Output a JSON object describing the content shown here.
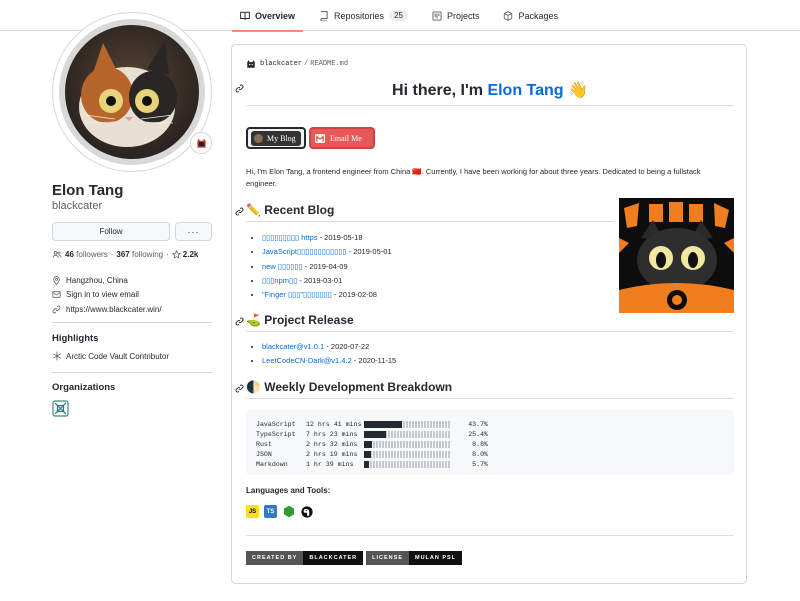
{
  "tabs": [
    {
      "label": "Overview",
      "active": true,
      "icon": "book-icon"
    },
    {
      "label": "Repositories",
      "count": "25",
      "icon": "repo-icon"
    },
    {
      "label": "Projects",
      "icon": "project-icon"
    },
    {
      "label": "Packages",
      "icon": "package-icon"
    }
  ],
  "profile": {
    "name": "Elon Tang",
    "login": "blackcater",
    "follow_label": "Follow",
    "more_label": "···",
    "followers_count": "46",
    "followers_label": "followers",
    "following_count": "367",
    "following_label": "following",
    "stars": "2.2k",
    "location": "Hangzhou, China",
    "email": "Sign in to view email",
    "website": "https://www.blackcater.win/"
  },
  "sidebar": {
    "highlights_title": "Highlights",
    "highlight_item": "Arctic Code Vault Contributor",
    "organizations_title": "Organizations"
  },
  "readme": {
    "path_user": "blackcater",
    "path_sep": "/",
    "path_file": "README.md",
    "greeting": "Hi there, I'm ",
    "greeting_name": "Elon Tang",
    "greeting_emoji": "👋",
    "badge_blog": "My Blog",
    "badge_email": "Email Me",
    "intro": "Hi, I'm Elon Tang, a frontend engineer from China 🇨🇳. Currently, I have been working for about three years. Dedicated to being a fullstack engineer.",
    "recent_blog_title": "✏️ Recent Blog",
    "blog_posts": [
      {
        "title": "▯▯▯▯▯▯▯▯▯ https",
        "date": " - 2019-05-18"
      },
      {
        "title": "JavaScript▯▯▯▯▯▯▯▯▯▯▯▯",
        "date": " - 2019-05-01"
      },
      {
        "title": "new ▯▯▯▯▯▯",
        "date": " - 2019-04-09"
      },
      {
        "title": "▯▯▯npm▯▯",
        "date": " - 2019-03-01"
      },
      {
        "title": "\"Finger ▯▯▯\"▯▯▯▯▯▯▯",
        "date": " - 2019-02-08"
      }
    ],
    "project_release_title": "⛳ Project Release",
    "releases": [
      {
        "title": "blackcater@v1.0.1",
        "date": " - 2020-07-22"
      },
      {
        "title": "LeetCodeCN-Dark@v1.4.2",
        "date": " - 2020-11-15"
      }
    ],
    "weekly_title": "🌓 Weekly Development Breakdown",
    "weekly": [
      {
        "lang": "JavaScript",
        "time": "12 hrs 41 mins",
        "percent": 43.7,
        "percent_label": "43.7%"
      },
      {
        "lang": "TypeScript",
        "time": "7 hrs 23 mins",
        "percent": 25.4,
        "percent_label": "25.4%"
      },
      {
        "lang": "Rust",
        "time": "2 hrs 32 mins",
        "percent": 8.8,
        "percent_label": "8.8%"
      },
      {
        "lang": "JSON",
        "time": "2 hrs 19 mins",
        "percent": 8.0,
        "percent_label": "8.0%"
      },
      {
        "lang": "Markdown",
        "time": "1 hr 39 mins",
        "percent": 5.7,
        "percent_label": "5.7%"
      }
    ],
    "tools_title": "Languages and Tools:",
    "tools": [
      {
        "icon": "javascript-icon",
        "text": "JS",
        "bg": "#f7df1e",
        "fg": "#000000"
      },
      {
        "icon": "typescript-icon",
        "text": "TS",
        "bg": "#3178c6",
        "fg": "#ffffff"
      },
      {
        "icon": "nodejs-icon",
        "text": "",
        "bg": "#ffffff",
        "fg": "#339933"
      },
      {
        "icon": "deno-icon",
        "text": "",
        "bg": "#ffffff",
        "fg": "#111111"
      }
    ],
    "footer": [
      {
        "label": "CREATED BY",
        "style": "grey"
      },
      {
        "label": "BLACKCATER",
        "style": "black"
      },
      {
        "label": "LICENSE",
        "style": "grey"
      },
      {
        "label": "MULAN PSL",
        "style": "black"
      }
    ]
  },
  "colors": {
    "accent": "#0969da",
    "tab_underline": "#fd8c73",
    "border": "#d0d7de",
    "email_badge": "#e85858"
  }
}
